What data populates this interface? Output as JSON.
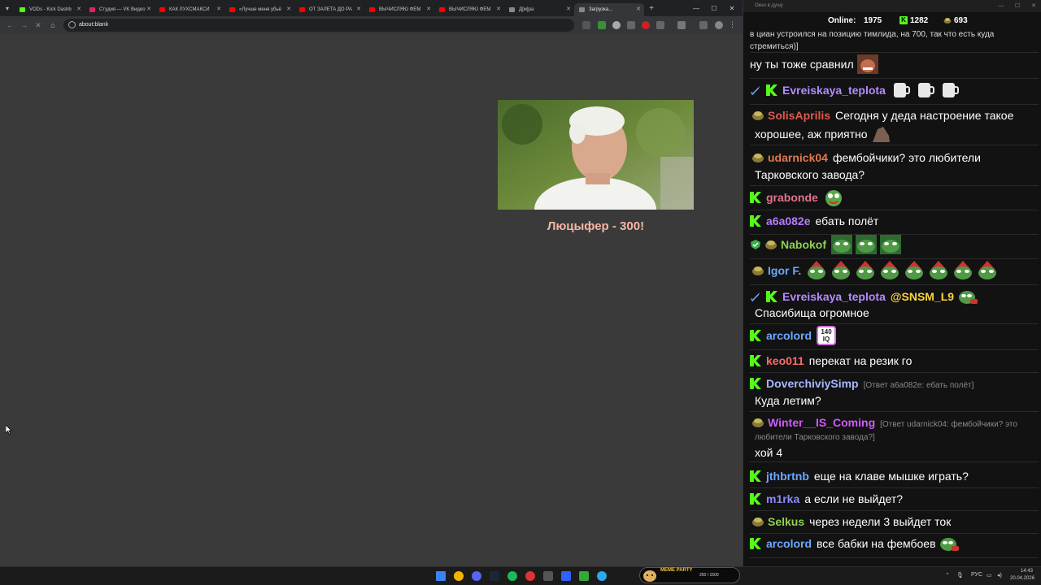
{
  "browser": {
    "tabs": [
      {
        "title": "VODs - Kick Dashb",
        "color": "#53fc18",
        "active": false
      },
      {
        "title": "Студия — VK Видео",
        "color": "#e0245e",
        "active": false
      },
      {
        "title": "КАК ЛУХСМАКСИ",
        "color": "#ff0000",
        "active": false
      },
      {
        "title": "«Лучше меня убьё",
        "color": "#ff0000",
        "active": false
      },
      {
        "title": "ОТ ЗАЛЕТА ДО РА",
        "color": "#ff0000",
        "active": false
      },
      {
        "title": "ВЫЧИСЛЯЮ ФЕМ",
        "color": "#ff0000",
        "active": false
      },
      {
        "title": "ВЫЧИСЛЯЮ ФЕМ",
        "color": "#ff0000",
        "active": false
      },
      {
        "title": "Д[м]ра",
        "color": "#888888",
        "active": false
      },
      {
        "title": "Загрузка...",
        "color": "#888888",
        "active": true
      }
    ],
    "new_tab": "+",
    "url": "about:blank"
  },
  "alert": {
    "text": "Люцыфер - 300!"
  },
  "chat": {
    "window_title": "Окно в душу",
    "online_label": "Online:",
    "online_count": "1975",
    "kick_count": "1282",
    "pot_count": "693",
    "messages": [
      {
        "text": "в циан устроился на позицию тимлида, на 700, так что есть куда",
        "text2": "стремиться)]",
        "small": true
      },
      {
        "text": "ну ты тоже сравнил"
      },
      {
        "user": "Evreiskaya_teplota",
        "user_color": "#b48cff",
        "text": ""
      },
      {
        "user": "SolisAprilis",
        "user_color": "#e05a4e",
        "text": "Сегодня у деда настроение такое",
        "text2": "хорошее, аж приятно"
      },
      {
        "user": "udarnick04",
        "user_color": "#e07a4e",
        "text": "фембойчики? это любители",
        "text2": "Тарковского завода?"
      },
      {
        "user": "grabonde",
        "user_color": "#e0748e",
        "text": ""
      },
      {
        "user": "a6a082e",
        "user_color": "#b67cff",
        "text": "ебать полёт"
      },
      {
        "user": "Nabokof",
        "user_color": "#8fd14f",
        "text": ""
      },
      {
        "user": "Igor F.",
        "user_color": "#6aa8ff",
        "text": ""
      },
      {
        "user": "Evreiskaya_teplota",
        "user_color": "#b48cff",
        "mention": "@SNSM_L9",
        "text": "",
        "text2": "Спасибища огромное"
      },
      {
        "user": "arcolord",
        "user_color": "#6aa8ff",
        "text": "",
        "emote_text": "140 IQ"
      },
      {
        "user": "keo011",
        "user_color": "#ff6a6a",
        "text": "перекат на резик го"
      },
      {
        "user": "DoverchiviySimp",
        "user_color": "#a8b8ff",
        "reply": "[Ответ a6a082e: ебать полёт]",
        "text": "",
        "text2": "Куда летим?"
      },
      {
        "user": "Winter__IS_Coming",
        "user_color": "#d05aff",
        "reply": "[Ответ udarnick04: фембойчики? это",
        "reply2": "любители Тарковского завода?]",
        "text": "",
        "text2": "хой 4"
      },
      {
        "user": "jthbrtnb",
        "user_color": "#6aa8ff",
        "text": "еще на клаве мышке играть?"
      },
      {
        "user": "m1rka",
        "user_color": "#8a8aff",
        "text": "а если не выйдет?"
      },
      {
        "user": "Selkus",
        "user_color": "#8fd14f",
        "text": "через недели 3 выйдет ток"
      },
      {
        "user": "arcolord",
        "user_color": "#6aa8ff",
        "text": "все бабки на фембоев"
      }
    ]
  },
  "taskbar": {
    "meme_label": "MEME PARTY",
    "meme_progress": "250 / 1500",
    "lang": "РУС",
    "time": "14:43",
    "date": "20.04.2026"
  }
}
